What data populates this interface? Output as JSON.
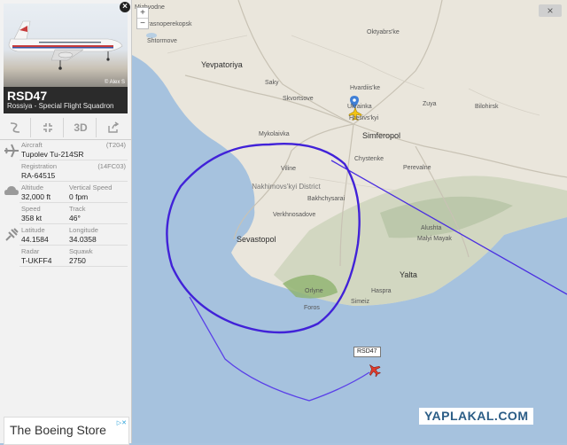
{
  "panel": {
    "photo_credit": "© Alex S",
    "close_glyph": "×",
    "callsign": "RSD47",
    "airline": "Rossiya - Special Flight Squadron",
    "toolbar": {
      "route_icon": "route-icon",
      "fullscreen_icon": "fullscreen-icon",
      "view3d_label": "3D",
      "share_icon": "share-icon"
    },
    "aircraft": {
      "aircraft_label": "Aircraft",
      "aircraft_value": "Tupolev Tu-214SR",
      "aircraft_code": "(T204)",
      "registration_label": "Registration",
      "registration_value": "RA-64515",
      "registration_code": "(14FC03)"
    },
    "flight": {
      "altitude_label": "Altitude",
      "altitude_value": "32,000 ft",
      "vspeed_label": "Vertical Speed",
      "vspeed_value": "0 fpm",
      "speed_label": "Speed",
      "speed_value": "358 kt",
      "track_label": "Track",
      "track_value": "46°"
    },
    "position": {
      "latitude_label": "Latitude",
      "latitude_value": "44.1584",
      "longitude_label": "Longitude",
      "longitude_value": "34.0358"
    },
    "radar": {
      "radar_label": "Radar",
      "radar_value": "T-UKFF4",
      "squawk_label": "Squawk",
      "squawk_value": "2750"
    }
  },
  "ad": {
    "text": "The Boeing Store",
    "badge": "▷✕"
  },
  "map": {
    "zoom_in": "+",
    "zoom_out": "−",
    "close_glyph": "×",
    "flight_label": "RSD47",
    "watermark": "YAPLAKAL.COM",
    "track_color": "#4a2ee0",
    "labels": {
      "oktyabrske": "Oktyabrs'ke",
      "krasnoperekopsk": "Krasnoperekopsk",
      "shtormove": "Shtormove",
      "mizhvodne": "Mizhvodne",
      "yevpatoriya": "Yevpatoriya",
      "saky": "Saky",
      "skvortsove": "Skvortsove",
      "hvardiiske": "Hvardiis'ke",
      "ukrainka": "Ukrainka",
      "zuya": "Zuya",
      "bilohirsk": "Bilohirsk",
      "mykolaivka": "Mykolaivka",
      "hresivskyi": "Hresivs'kyi",
      "simferopol": "Simferopol",
      "chystenke": "Chystenke",
      "viline": "Viline",
      "perevalne": "Perevalne",
      "nakhimovskyi": "Nakhimovs'kyi District",
      "bakhchysarai": "Bakhchysarai",
      "verkhnosadove": "Verkhnosadove",
      "sevastopol": "Sevastopol",
      "malyi_mayak": "Malyi Mayak",
      "alushta": "Alushta",
      "yalta": "Yalta",
      "orlyne": "Orlyne",
      "foros": "Foros",
      "haspra": "Haspra",
      "simeiz": "Simeiz"
    }
  }
}
